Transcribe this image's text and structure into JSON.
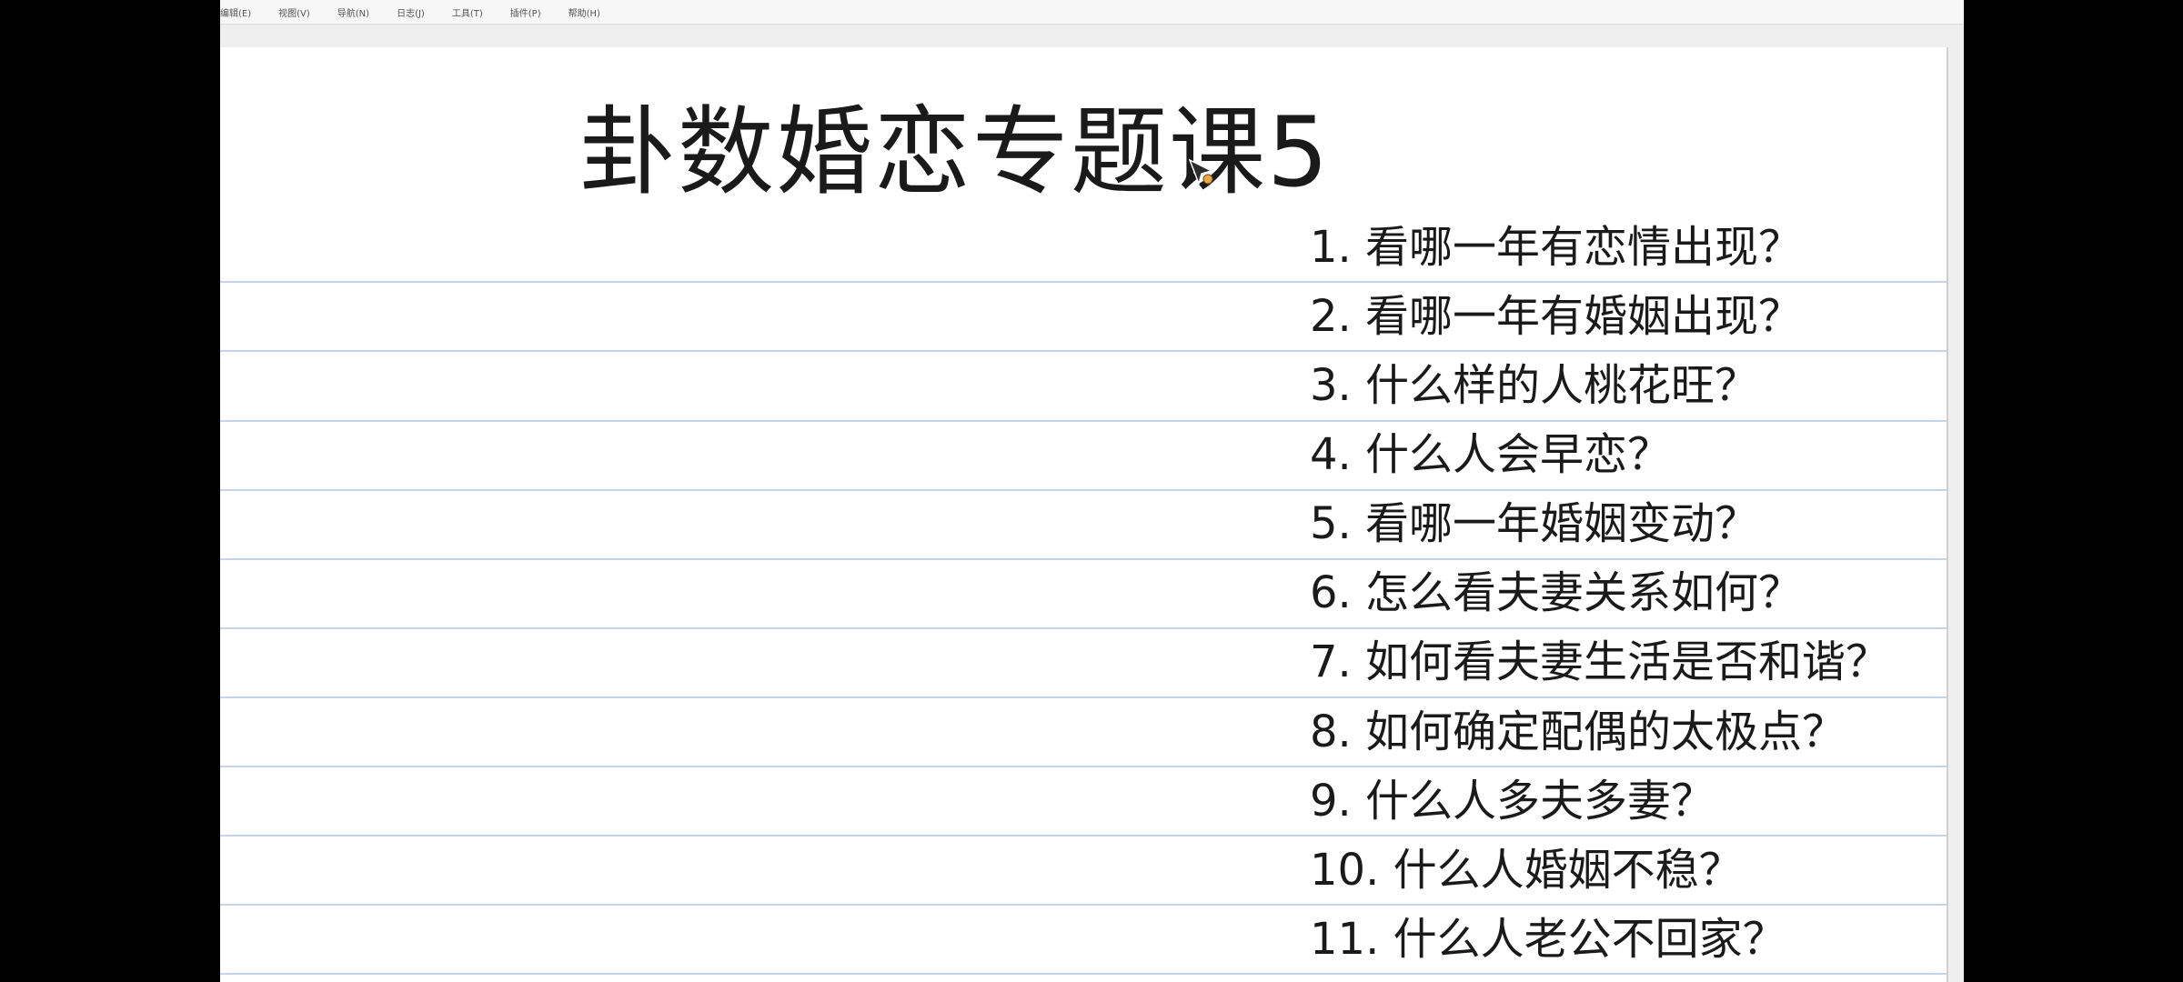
{
  "menubar": {
    "items": [
      "编辑(E)",
      "视图(V)",
      "导航(N)",
      "日志(J)",
      "工具(T)",
      "插件(P)",
      "帮助(H)"
    ]
  },
  "page": {
    "title": "卦数婚恋专题课5",
    "questions": [
      "1. 看哪一年有恋情出现？",
      "2. 看哪一年有婚姻出现？",
      "3. 什么样的人桃花旺？",
      "4. 什么人会早恋？",
      "5. 看哪一年婚姻变动？",
      "6. 怎么看夫妻关系如何？",
      "7. 如何看夫妻生活是否和谐？",
      "8. 如何确定配偶的太极点？",
      "9. 什么人多夫多妻？",
      "10. 什么人婚姻不稳？",
      "11. 什么人老公不回家？"
    ]
  },
  "colors": {
    "page_background": "#ffffff",
    "rule_line": "#c5d4ea",
    "text": "#1a1a1a",
    "outer_background": "#000000"
  },
  "icons": {
    "cursor": "pen-cursor-icon"
  }
}
